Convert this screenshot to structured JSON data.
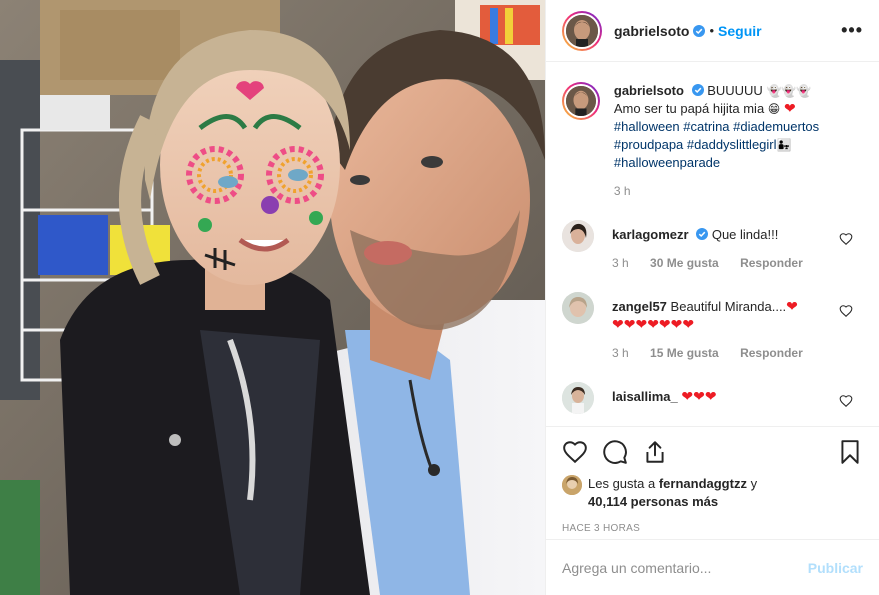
{
  "post": {
    "author": "gabrielsoto",
    "follow_label": "Seguir",
    "more_label": "•••",
    "separator": "•"
  },
  "caption": {
    "username": "gabrielsoto",
    "text_line1": "BUUUUU",
    "text_line2": "Amo ser tu papá hijita mia",
    "hashtags_line1": [
      "#halloween",
      "#catrina",
      "#diademuertos"
    ],
    "hashtags_line2": [
      "#proudpapa",
      "#daddyslittlegirl"
    ],
    "hashtags_line3": [
      "#halloweenparade"
    ],
    "time": "3 h"
  },
  "comments": [
    {
      "username": "karlagomezr",
      "verified": true,
      "text": "Que linda!!!",
      "time": "3 h",
      "likes": "30 Me gusta",
      "reply": "Responder"
    },
    {
      "username": "zangel57",
      "verified": false,
      "text": "Beautiful Miranda....",
      "time": "3 h",
      "likes": "15 Me gusta",
      "reply": "Responder"
    },
    {
      "username": "laisallima_",
      "verified": false,
      "text": ""
    }
  ],
  "likes": {
    "prefix": "Les gusta a",
    "user": "fernandaggtzz",
    "joiner": "y",
    "count": "40,114 personas más"
  },
  "timestamp": "HACE 3 HORAS",
  "add_comment": {
    "placeholder": "Agrega un comentario...",
    "publish_label": "Publicar"
  },
  "colors": {
    "link_blue": "#0095f6",
    "hashtag": "#003569",
    "secondary_text": "#8e8e8e",
    "heart_red": "#ed1c24",
    "publish_disabled": "#b2dffc"
  },
  "icons": [
    "verified-icon",
    "more-icon",
    "heart-icon",
    "comment-icon",
    "share-icon",
    "bookmark-icon",
    "ghost-emoji",
    "grin-emoji",
    "family-emoji"
  ]
}
